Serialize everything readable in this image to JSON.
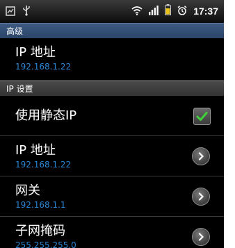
{
  "status_bar": {
    "time": "17:37",
    "left_icons": [
      "screenshot-icon",
      "usb-icon"
    ],
    "right_icons": [
      "wifi-icon",
      "signal-icon",
      "battery-icon",
      "alarm-icon"
    ]
  },
  "sections": {
    "advanced_label": "高级",
    "ip_settings_label": "IP 设置"
  },
  "items": {
    "ip_address_top": {
      "title": "IP 地址",
      "value": "192.168.1.22"
    },
    "use_static_ip": {
      "title": "使用静态IP",
      "checked": true
    },
    "ip_address": {
      "title": "IP 地址",
      "value": "192.168.1.22"
    },
    "gateway": {
      "title": "网关",
      "value": "192.168.1.1"
    },
    "subnet_mask": {
      "title": "子网掩码",
      "value": "255.255.255.0"
    }
  },
  "colors": {
    "value_blue": "#2a87d6",
    "check_green": "#3fd13a",
    "section_blue": "#2f4b73"
  }
}
